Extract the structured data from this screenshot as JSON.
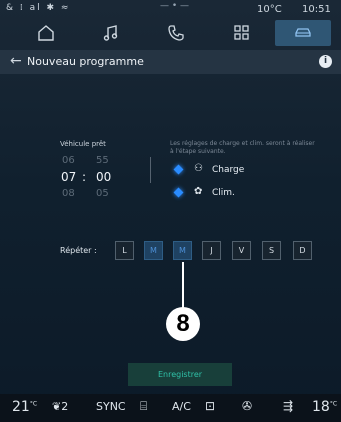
{
  "status_bar": {
    "left_icons": "& ⁞ al ✱ ≈",
    "center_marker": "— • —",
    "temperature": "10°C",
    "time": "10:51"
  },
  "tabs": [
    {
      "icon": "home-icon",
      "active": false
    },
    {
      "icon": "music-icon",
      "active": false
    },
    {
      "icon": "phone-icon",
      "active": false
    },
    {
      "icon": "apps-icon",
      "active": false
    },
    {
      "icon": "car-icon",
      "active": true
    }
  ],
  "header": {
    "back_glyph": "←",
    "title": "Nouveau programme",
    "info_glyph": "i"
  },
  "ready": {
    "label": "Véhicule prêt",
    "prev_hour": "06",
    "prev_minute": "55",
    "hour": "07",
    "separator": ":",
    "minute": "00",
    "next_hour": "08",
    "next_minute": "05"
  },
  "settings_note": "Les réglages de charge et clim. seront à réaliser à l'étape suivante.",
  "options": [
    {
      "label": "Charge",
      "icon": "charge-icon",
      "enabled": true
    },
    {
      "label": "Clim.",
      "icon": "climate-icon",
      "enabled": true
    }
  ],
  "repeat": {
    "label": "Répéter :",
    "days": [
      {
        "label": "L",
        "selected": false
      },
      {
        "label": "M",
        "selected": true
      },
      {
        "label": "M",
        "selected": true
      },
      {
        "label": "J",
        "selected": false
      },
      {
        "label": "V",
        "selected": false
      },
      {
        "label": "S",
        "selected": false
      },
      {
        "label": "D",
        "selected": false
      }
    ]
  },
  "callout_number": "8",
  "save_label": "Enregistrer",
  "bottom_bar": {
    "left_temp": "21",
    "left_temp_unit": "°C",
    "seat_heat": "2",
    "sync": "SYNC",
    "ac": "A/C",
    "right_temp": "18",
    "right_temp_unit": "°C"
  },
  "colors": {
    "accent_blue": "#2a8cff",
    "active_tab": "#2f5674",
    "save_text": "#2fc0a7"
  }
}
